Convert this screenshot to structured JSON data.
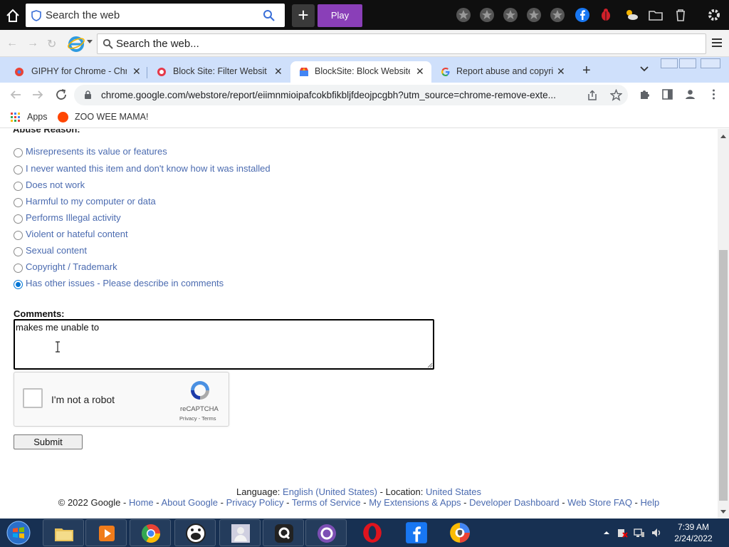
{
  "topbar": {
    "search_placeholder": "Search the web",
    "play_label": "Play"
  },
  "searchbar2": {
    "placeholder": "Search the web..."
  },
  "tabs": [
    {
      "label": "GIPHY for Chrome - Chro"
    },
    {
      "label": "Block Site: Filter Websites"
    },
    {
      "label": "BlockSite: Block Websites"
    },
    {
      "label": "Report abuse and copyrig"
    }
  ],
  "address": {
    "url": "chrome.google.com/webstore/report/eiimnmioipafcokbfikbljfdeojpcgbh?utm_source=chrome-remove-exte..."
  },
  "bookmarks": {
    "apps": "Apps",
    "zoo": "ZOO WEE MAMA!"
  },
  "form": {
    "abuse_heading": "Abuse Reason:",
    "reasons": [
      {
        "label": "Misrepresents its value or features",
        "selected": false
      },
      {
        "label": "I never wanted this item and don't know how it was installed",
        "selected": false
      },
      {
        "label": "Does not work",
        "selected": false
      },
      {
        "label": "Harmful to my computer or data",
        "selected": false
      },
      {
        "label": "Performs Illegal activity",
        "selected": false
      },
      {
        "label": "Violent or hateful content",
        "selected": false
      },
      {
        "label": "Sexual content",
        "selected": false
      },
      {
        "label": "Copyright / Trademark",
        "selected": false
      },
      {
        "label": "Has other issues - Please describe in comments",
        "selected": true
      }
    ],
    "comments_label": "Comments:",
    "comments_value": "makes me unable to",
    "captcha_label": "I'm not a robot",
    "captcha_brand": "reCAPTCHA",
    "captcha_links": "Privacy - Terms",
    "submit_label": "Submit"
  },
  "footer": {
    "language_label": "Language:",
    "language_value": "English (United States)",
    "location_label": "Location:",
    "location_value": "United States",
    "copyright": "© 2022 Google",
    "links": [
      "Home",
      "About Google",
      "Privacy Policy",
      "Terms of Service",
      "My Extensions & Apps",
      "Developer Dashboard",
      "Web Store FAQ",
      "Help"
    ]
  },
  "clock": {
    "time": "7:39 AM",
    "date": "2/24/2022"
  },
  "colors": {
    "link": "#4b6bb0",
    "tabstrip": "#cfe0fb",
    "taskbar": "#173052",
    "play": "#8a3fb8"
  }
}
